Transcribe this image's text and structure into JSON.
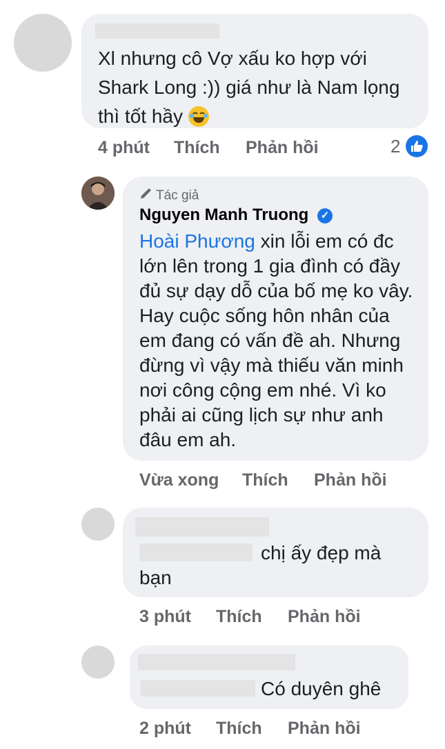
{
  "comment1": {
    "text": "Xl nhưng cô Vợ xấu ko hợp với Shark Long :)) giá như là Nam lọng thì tốt hầy",
    "emoji": "laughing-emoji",
    "time": "4 phút",
    "like": "Thích",
    "reply": "Phản hồi",
    "reaction_count": "2",
    "reaction_icon": "like-icon"
  },
  "author_reply": {
    "badge_label": "Tác giả",
    "badge_icon": "pencil-icon",
    "name": "Nguyen Manh Truong",
    "verified_icon": "verified-check-icon",
    "mention": "Hoài Phương",
    "text": " xin lỗi em có đc lớn lên trong 1 gia đình có đầy đủ sự dạy dỗ của bố mẹ ko vây. Hay cuộc sống hôn nhân của em đang có vấn đề ah. Nhưng đừng vì vậy mà thiếu văn minh nơi công cộng em nhé. Vì ko phải ai cũng lịch sự như anh đâu em ah.",
    "time": "Vừa xong",
    "like": "Thích",
    "reply": "Phản hồi"
  },
  "reply2": {
    "text": "chị ấy đẹp mà bạn",
    "time": "3 phút",
    "like": "Thích",
    "reply": "Phản hồi"
  },
  "reply3": {
    "text": "Có duyên ghê",
    "time": "2 phút",
    "like": "Thích",
    "reply": "Phản hồi"
  },
  "colors": {
    "bubble": "#eef0f3",
    "link": "#1b74e4",
    "meta": "#65676b"
  }
}
